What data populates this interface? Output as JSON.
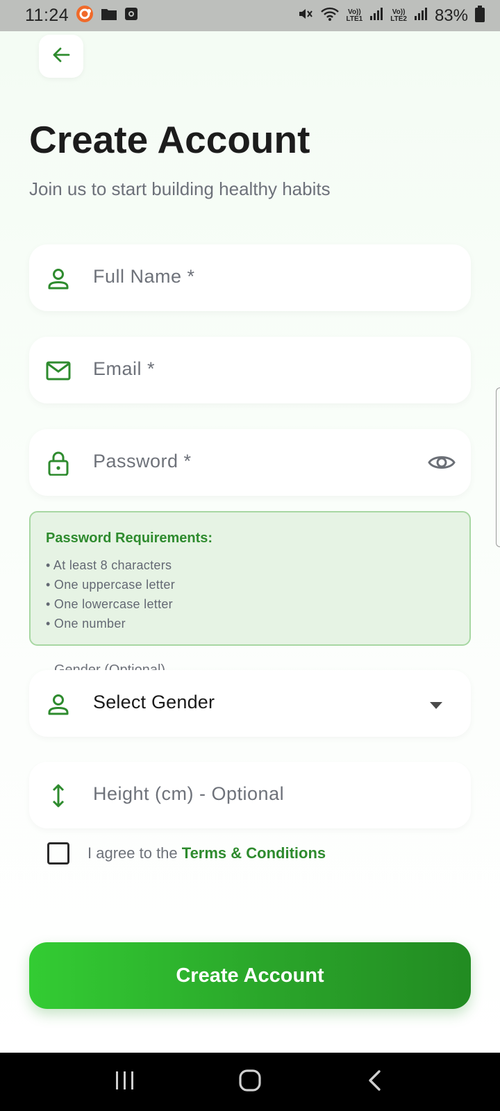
{
  "status_bar": {
    "time": "11:24",
    "battery": "83%",
    "sim1": {
      "top": "Vo))",
      "bottom": "LTE1"
    },
    "sim2": {
      "top": "Vo))",
      "bottom": "LTE2"
    },
    "icons": [
      "app-notification-icon",
      "folder-icon",
      "media-icon",
      "mute-icon",
      "wifi-icon",
      "signal-icon",
      "battery-icon"
    ]
  },
  "header": {
    "back_icon": "arrow-left-icon",
    "title": "Create Account",
    "subtitle": "Join us to start building healthy habits"
  },
  "form": {
    "full_name": {
      "placeholder": "Full Name *",
      "icon": "person-icon"
    },
    "email": {
      "placeholder": "Email *",
      "icon": "mail-icon"
    },
    "password": {
      "placeholder": "Password *",
      "icon": "lock-icon",
      "toggle_icon": "eye-icon"
    },
    "password_requirements": {
      "title": "Password Requirements:",
      "items": [
        "• At least 8 characters",
        "• One uppercase letter",
        "• One lowercase letter",
        "• One number"
      ]
    },
    "gender": {
      "label": "Gender (Optional)",
      "value": "Select Gender",
      "icon": "person-icon",
      "arrow_icon": "caret-down-icon"
    },
    "height": {
      "placeholder": "Height (cm) - Optional",
      "icon": "vertical-arrows-icon"
    },
    "terms": {
      "prefix": "I agree to the ",
      "link": "Terms & Conditions",
      "checked": false
    },
    "submit_label": "Create Account"
  },
  "colors": {
    "accent": "#2e8b2e",
    "button_start": "#33cc33",
    "button_end": "#228b22",
    "requirements_bg": "#e6f3e4"
  },
  "nav_bar": {
    "icons": [
      "recents-icon",
      "home-icon",
      "back-icon"
    ]
  }
}
